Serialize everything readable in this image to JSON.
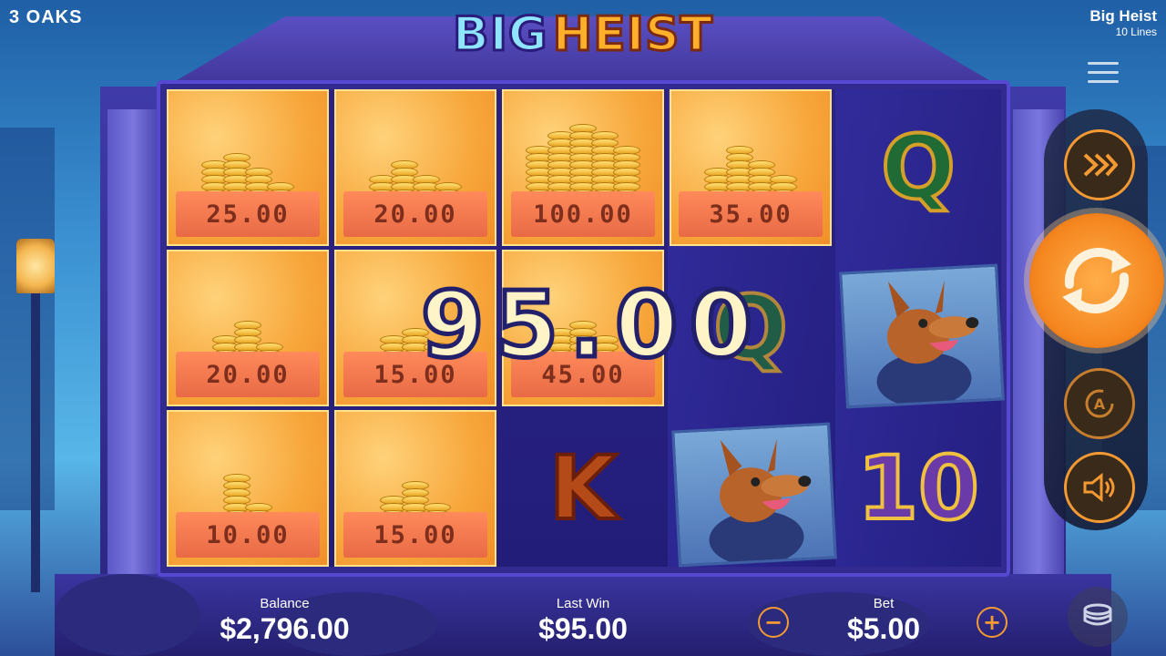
{
  "brand": "3 OAKS",
  "logo": {
    "big": "BIG",
    "heist": "HEIST"
  },
  "game": {
    "title": "Big Heist",
    "lines": "10 Lines"
  },
  "tiles": [
    {
      "value": "25.00"
    },
    {
      "value": "20.00"
    },
    {
      "value": "100.00"
    },
    {
      "value": "35.00"
    },
    {
      "value": "20.00"
    },
    {
      "value": "15.00"
    },
    {
      "value": "45.00"
    },
    {
      "value": "10.00"
    },
    {
      "value": "15.00"
    }
  ],
  "symbols": {
    "q1": "Q",
    "q2": "Q",
    "k": "K",
    "ten": "10"
  },
  "win_amount": "95.00",
  "bottom": {
    "balance_label": "Balance",
    "balance_value": "$2,796.00",
    "last_win_label": "Last Win",
    "last_win_value": "$95.00",
    "bet_label": "Bet",
    "bet_value": "$5.00",
    "minus": "−",
    "plus": "+"
  },
  "icons": {
    "menu": "menu-icon",
    "turbo": "fast-forward-icon",
    "spin": "spin-icon",
    "auto": "autoplay-icon",
    "sound": "speaker-icon",
    "stack": "coin-stack-icon"
  },
  "colors": {
    "accent": "#f59a33",
    "tile": "#f7a63a",
    "reel_bg": "#231d7a"
  }
}
